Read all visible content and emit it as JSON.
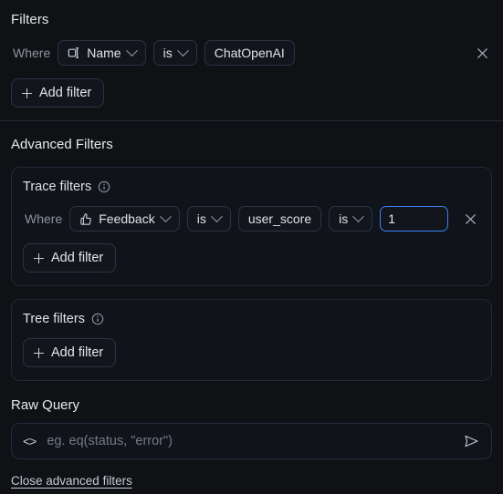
{
  "colors": {
    "page_bg": "#0f1115",
    "panel_bg": "#101319",
    "border": "#2b3443",
    "accent_focus": "#3b82f6",
    "text_primary": "#e6e9ee",
    "text_muted": "#8b93a1"
  },
  "filters": {
    "heading": "Filters",
    "row": {
      "where_label": "Where",
      "field_icon": "string-type-icon",
      "field_label": "Name",
      "operator_label": "is",
      "value": "ChatOpenAI",
      "remove_label": "×"
    },
    "add_filter_label": "Add filter"
  },
  "advanced": {
    "title": "Advanced Filters",
    "trace_filters": {
      "title": "Trace filters",
      "info_icon": "info-circle-icon",
      "row": {
        "where_label": "Where",
        "field_icon": "thumbs-up-icon",
        "field_label": "Feedback",
        "operator_label": "is",
        "key_value": "user_score",
        "operator2_label": "is",
        "value": "1",
        "value_placeholder": "",
        "remove_label": "×"
      },
      "add_filter_label": "Add filter"
    },
    "tree_filters": {
      "title": "Tree filters",
      "info_icon": "info-circle-icon",
      "add_filter_label": "Add filter"
    }
  },
  "raw_query": {
    "title": "Raw Query",
    "code_icon": "<>",
    "placeholder": "eg. eq(status, \"error\")",
    "value": "",
    "send_icon": "send-icon"
  },
  "footer": {
    "close_advanced_label": "Close advanced filters"
  }
}
